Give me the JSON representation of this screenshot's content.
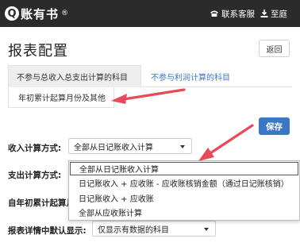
{
  "topbar": {
    "logo_glyph": "Q",
    "brand_name": "账有书",
    "brand_reg": "®",
    "service_label": "联系客服",
    "user_label": "至庭"
  },
  "page": {
    "title": "报表配置",
    "back_label": "返回",
    "save_label": "保存"
  },
  "tabs": [
    {
      "label": "不参与总收入总支出计算的科目",
      "active": true
    },
    {
      "label": "不参与利润计算的科目",
      "active": false
    },
    {
      "label": "年初累计起算月份及其他",
      "active": false
    }
  ],
  "form": {
    "income_label": "收入计算方式:",
    "income_value": "全部从日记账收入计算",
    "expense_label": "支出计算方式:",
    "year_label": "自年初累计起算月",
    "detail_label": "报表详情中默认显示:",
    "detail_value": "仅显示有数据的科目"
  },
  "dropdown": {
    "options": [
      "全部从日记账收入计算",
      "日记账收入 + 应收账 - 应收账核销金额（通过日记账核销）",
      "日记账收入 + 应收账",
      "全部从应收账计算"
    ],
    "selected_index": 0
  },
  "colors": {
    "topbar_bg": "#2b2b2b",
    "accent_blue": "#3a78c3",
    "annotation_arrow": "#e94a5a"
  }
}
